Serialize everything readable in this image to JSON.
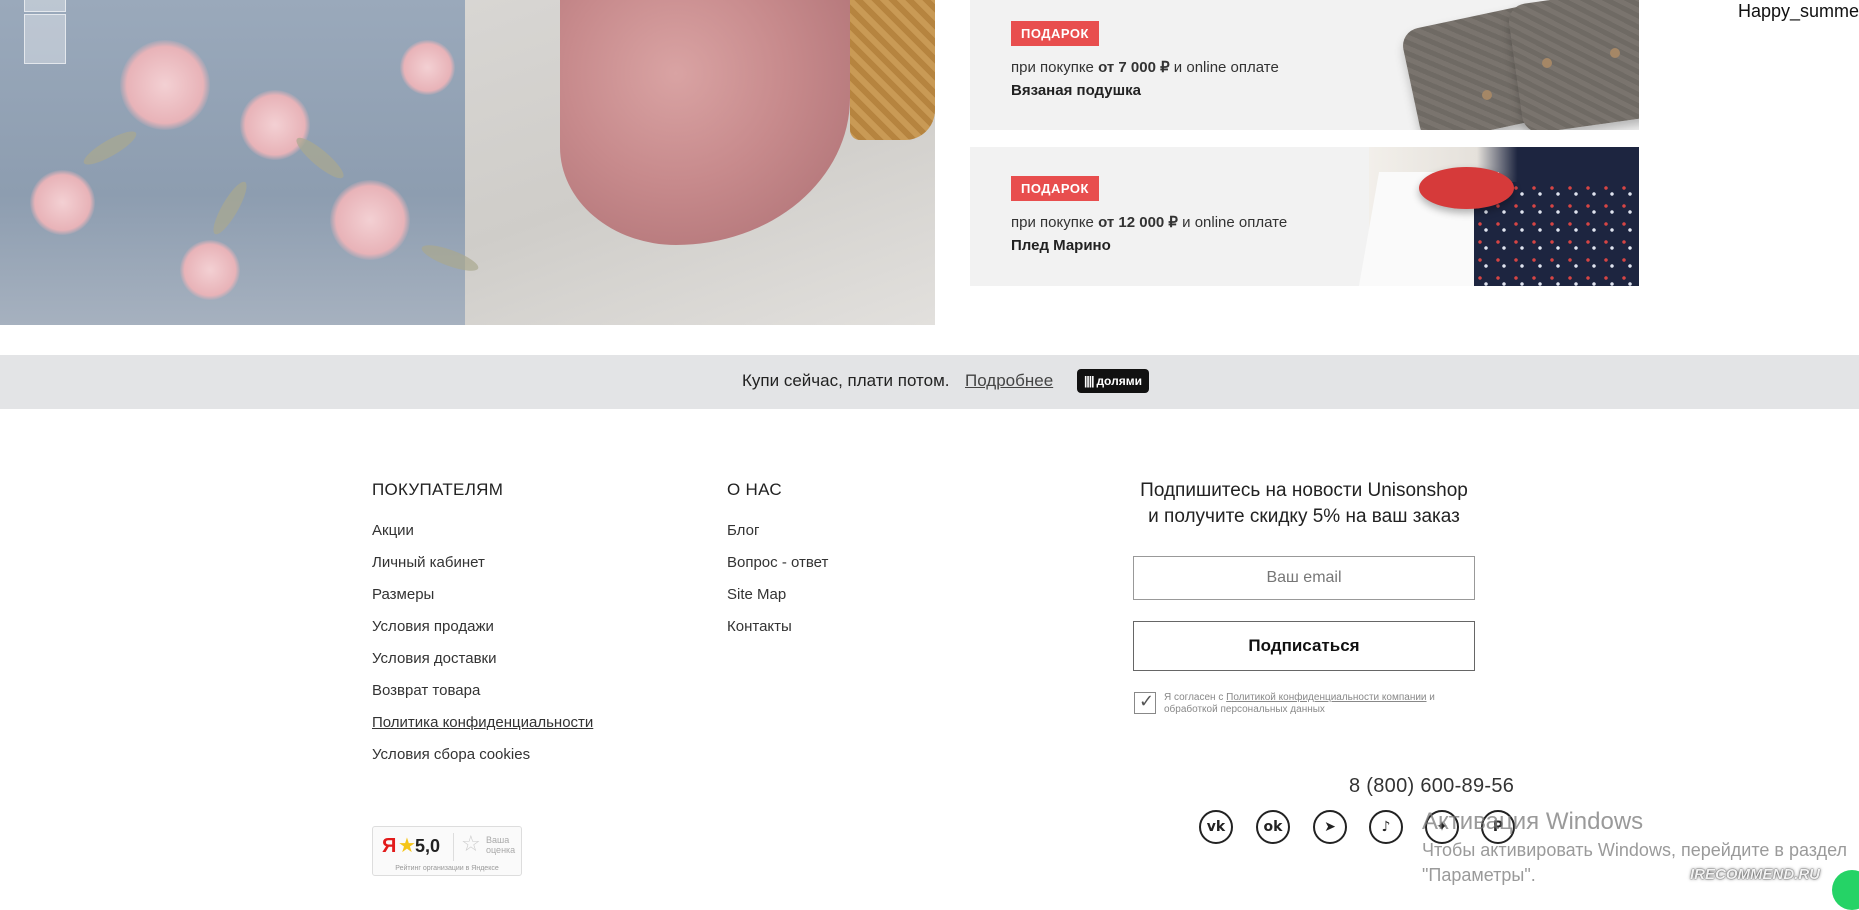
{
  "user": {
    "name": "Happy_summer"
  },
  "gifts": [
    {
      "badge": "ПОДАРОК",
      "cond_pre": "при покупке ",
      "cond_amount": "от 7 000 ₽",
      "cond_post": " и online оплате",
      "name": "Вязаная подушка"
    },
    {
      "badge": "ПОДАРОК",
      "cond_pre": "при покупке ",
      "cond_amount": "от 12 000 ₽",
      "cond_post": " и online оплате",
      "name": "Плед Марино"
    }
  ],
  "bnpl": {
    "text": "Купи сейчас, плати потом.",
    "link": "Подробнее",
    "badge": "долями",
    "badge_icon": "||||"
  },
  "footer": {
    "buyers": {
      "title": "ПОКУПАТЕЛЯМ",
      "links": [
        "Акции",
        "Личный кабинет",
        "Размеры",
        "Условия продажи",
        "Условия доставки",
        "Возврат товара",
        "Политика конфиденциальности",
        "Условия сбора cookies"
      ]
    },
    "about": {
      "title": "О НАС",
      "links": [
        "Блог",
        "Вопрос - ответ",
        "Site Map",
        "Контакты"
      ]
    },
    "newsletter": {
      "title_line1": "Подпишитесь на новости Unisonshop",
      "title_line2": "и получите скидку 5% на ваш заказ",
      "email_placeholder": "Ваш email",
      "button": "Подписаться",
      "consent_pre": "Я согласен с ",
      "consent_link": "Политикой конфиденциальности компании",
      "consent_post": " и обработкой персональных данных",
      "checked": true
    },
    "phone": "8 (800) 600-89-56",
    "social": [
      {
        "icon": "vk-icon",
        "glyph": "vk"
      },
      {
        "icon": "odnoklassniki-icon",
        "glyph": "ok"
      },
      {
        "icon": "telegram-icon",
        "glyph": "➤"
      },
      {
        "icon": "tiktok-icon",
        "glyph": "♪"
      },
      {
        "icon": "dzen-icon",
        "glyph": "✦"
      },
      {
        "icon": "pinterest-icon",
        "glyph": "P"
      }
    ],
    "rating": {
      "logo": "Я",
      "score": "5,0",
      "your_label": "Ваша оценка",
      "caption": "Рейтинг организации в Яндексе"
    }
  },
  "windows_overlay": {
    "title": "Активация Windows",
    "subtitle": "Чтобы активировать Windows, перейдите в раздел \"Параметры\"."
  },
  "watermark": "IRECOMMEND.RU",
  "colors": {
    "badge_red": "#e84e4e",
    "strip_bg": "#e3e4e6",
    "gift_bg": "#f2f2f2"
  }
}
